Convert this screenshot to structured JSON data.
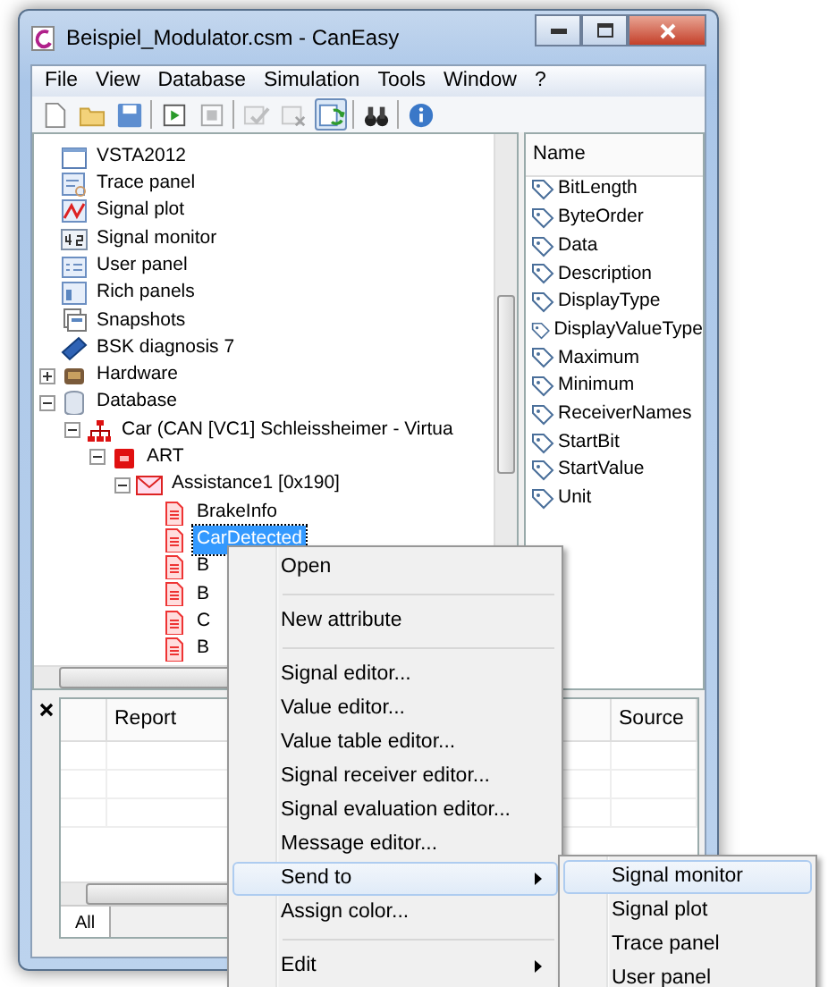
{
  "window": {
    "title": "Beispiel_Modulator.csm - CanEasy"
  },
  "menu_bar": [
    "File",
    "View",
    "Database",
    "Simulation",
    "Tools",
    "Window",
    "?"
  ],
  "toolbar": [
    {
      "kind": "new",
      "pressed": false,
      "disabled": false
    },
    {
      "kind": "open",
      "pressed": false,
      "disabled": false
    },
    {
      "kind": "save",
      "pressed": false,
      "disabled": false
    },
    {
      "kind": "sep"
    },
    {
      "kind": "start",
      "pressed": false,
      "disabled": false
    },
    {
      "kind": "stop",
      "pressed": false,
      "disabled": true
    },
    {
      "kind": "sep"
    },
    {
      "kind": "check",
      "pressed": false,
      "disabled": true
    },
    {
      "kind": "uncheck",
      "pressed": false,
      "disabled": true
    },
    {
      "kind": "sync",
      "pressed": true,
      "disabled": false
    },
    {
      "kind": "sep"
    },
    {
      "kind": "find",
      "pressed": false,
      "disabled": false
    },
    {
      "kind": "sep"
    },
    {
      "kind": "info",
      "pressed": false,
      "disabled": false
    }
  ],
  "tree": [
    {
      "label": "VSTA2012",
      "kind": "window",
      "selected": false
    },
    {
      "label": "Trace panel",
      "kind": "trace",
      "selected": false
    },
    {
      "label": "Signal plot",
      "kind": "plot",
      "selected": false
    },
    {
      "label": "Signal monitor",
      "kind": "monitor",
      "selected": false
    },
    {
      "label": "User panel",
      "kind": "userpanel",
      "selected": false
    },
    {
      "label": "Rich panels",
      "kind": "rich",
      "selected": false
    },
    {
      "label": "Snapshots",
      "kind": "snapshot",
      "selected": false
    },
    {
      "label": "BSK diagnosis 7",
      "kind": "module",
      "selected": false
    },
    {
      "label": "Hardware",
      "kind": "hardware",
      "expanded": false,
      "selected": false
    },
    {
      "label": "Database",
      "kind": "database",
      "expanded": true,
      "selected": false,
      "children": [
        {
          "label": "Car (CAN [VC1] Schleissheimer - Virtua",
          "kind": "network",
          "expanded": true,
          "selected": false,
          "children": [
            {
              "label": "ART",
              "kind": "node",
              "expanded": true,
              "selected": false,
              "children": [
                {
                  "label": "Assistance1 [0x190]",
                  "kind": "message",
                  "expanded": true,
                  "selected": false,
                  "children": [
                    {
                      "label": "BrakeInfo",
                      "kind": "signal",
                      "selected": false
                    },
                    {
                      "label": "CarDetected",
                      "kind": "signal",
                      "selected": true
                    },
                    {
                      "label": "B",
                      "kind": "signal",
                      "selected": false
                    },
                    {
                      "label": "B",
                      "kind": "signal",
                      "selected": false
                    },
                    {
                      "label": "C",
                      "kind": "signal",
                      "selected": false
                    },
                    {
                      "label": "B",
                      "kind": "signal",
                      "selected": false
                    }
                  ]
                }
              ]
            }
          ]
        }
      ]
    }
  ],
  "attributes": {
    "header": "Name",
    "items": [
      "BitLength",
      "ByteOrder",
      "Data",
      "Description",
      "DisplayType",
      "DisplayValueType",
      "Maximum",
      "Minimum",
      "ReceiverNames",
      "StartBit",
      "StartValue",
      "Unit"
    ]
  },
  "report": {
    "columns": [
      "Report",
      "Source"
    ],
    "tabs": [
      {
        "label": "All",
        "selected": true
      }
    ]
  },
  "context_menu": [
    {
      "kind": "item",
      "label": "Open",
      "highlighted": false
    },
    {
      "kind": "sep"
    },
    {
      "kind": "item",
      "label": "New attribute",
      "highlighted": false
    },
    {
      "kind": "sep"
    },
    {
      "kind": "item",
      "label": "Signal editor...",
      "highlighted": false
    },
    {
      "kind": "item",
      "label": "Value editor...",
      "highlighted": false
    },
    {
      "kind": "item",
      "label": "Value table editor...",
      "highlighted": false
    },
    {
      "kind": "item",
      "label": "Signal receiver editor...",
      "highlighted": false
    },
    {
      "kind": "item",
      "label": "Signal evaluation editor...",
      "highlighted": false
    },
    {
      "kind": "item",
      "label": "Message editor...",
      "highlighted": false
    },
    {
      "kind": "submenu",
      "label": "Send to",
      "highlighted": true,
      "items": [
        {
          "label": "Signal monitor",
          "highlighted": true
        },
        {
          "label": "Signal plot",
          "highlighted": false
        },
        {
          "label": "Trace panel",
          "highlighted": false
        },
        {
          "label": "User panel",
          "highlighted": false
        }
      ]
    },
    {
      "kind": "item",
      "label": "Assign color...",
      "highlighted": false
    },
    {
      "kind": "sep"
    },
    {
      "kind": "submenu",
      "label": "Edit",
      "highlighted": false
    }
  ]
}
